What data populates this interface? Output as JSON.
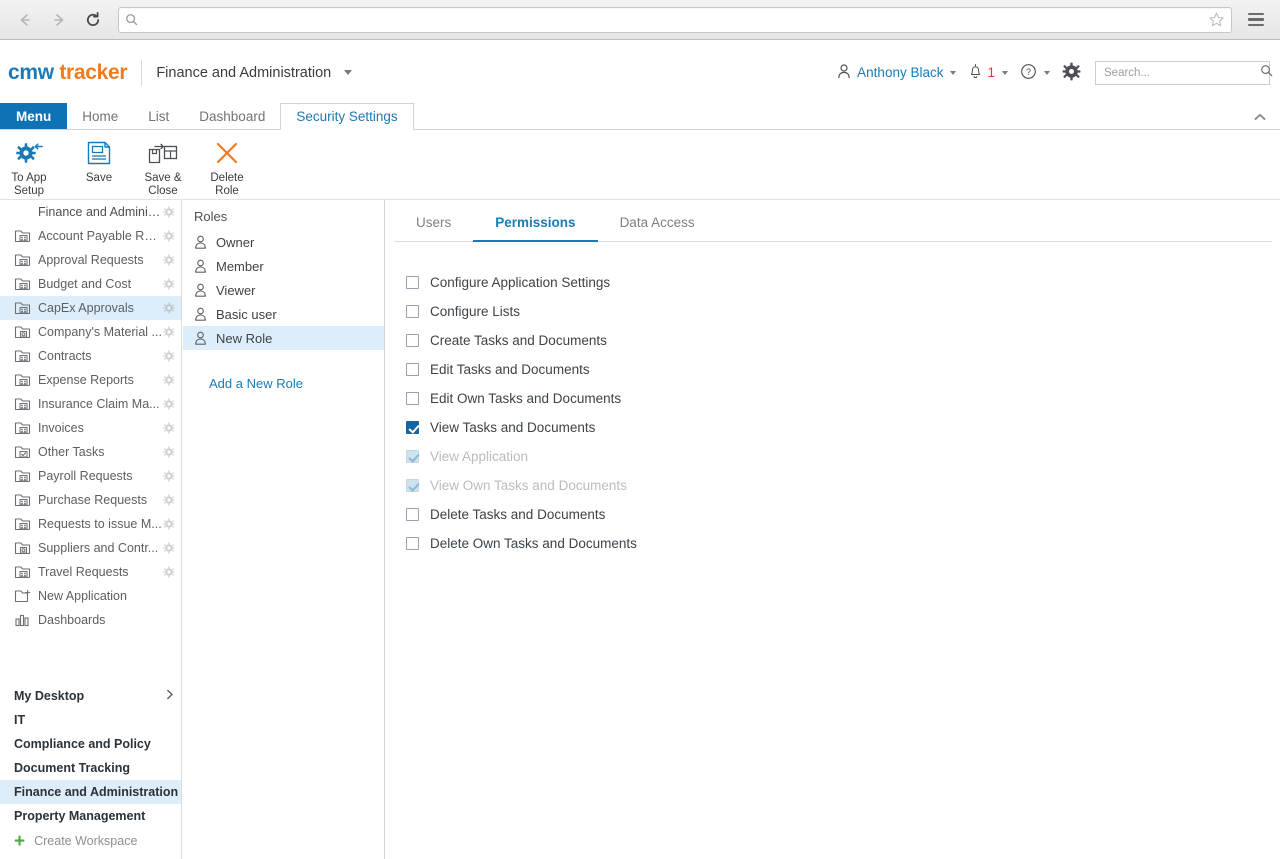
{
  "browser": {
    "back_icon": "arrow-left-icon",
    "forward_icon": "arrow-right-icon",
    "reload_icon": "reload-icon",
    "url_value": "",
    "url_placeholder": "",
    "url_search_icon": "search-icon",
    "bookmark_icon": "star-icon",
    "menu_icon": "hamburger-menu-icon"
  },
  "header": {
    "logo_primary": "cmw",
    "logo_secondary": "tracker",
    "workspace_name": "Finance and Administration",
    "user_icon": "person-icon",
    "user_name": "Anthony Black",
    "bell_icon": "bell-icon",
    "notification_count": "1",
    "help_icon": "question-circle-icon",
    "settings_icon": "gear-icon",
    "search_placeholder": "Search...",
    "search_value": "",
    "search_icon": "search-icon"
  },
  "tabs": [
    {
      "label": "Menu",
      "state": "menu"
    },
    {
      "label": "Home",
      "state": "inactive"
    },
    {
      "label": "List",
      "state": "inactive"
    },
    {
      "label": "Dashboard",
      "state": "inactive"
    },
    {
      "label": "Security Settings",
      "state": "active"
    }
  ],
  "collapse_icon": "chevron-up-icon",
  "ribbon": [
    {
      "label": "To App Setup",
      "icon": "gear-back-arrow-icon",
      "color": "#1a7ab5"
    },
    {
      "label": "Save",
      "icon": "floppy-disk-icon",
      "color": "#1a7ab5"
    },
    {
      "label": "Save & Close",
      "icon": "save-and-close-icon",
      "color": "#4a5056"
    },
    {
      "label": "Delete Role",
      "icon": "x-cross-icon",
      "color": "#ef7b1f"
    }
  ],
  "sidebar": {
    "apps": [
      {
        "label": "Finance and Administrati...",
        "icon": "none",
        "gear": true,
        "selected": false,
        "root": true
      },
      {
        "label": "Account Payable Req...",
        "icon": "app-icon",
        "gear": true,
        "selected": false
      },
      {
        "label": "Approval Requests",
        "icon": "app-icon",
        "gear": true,
        "selected": false
      },
      {
        "label": "Budget and Cost",
        "icon": "app-icon",
        "gear": true,
        "selected": false
      },
      {
        "label": "CapEx Approvals",
        "icon": "app-icon",
        "gear": true,
        "selected": true
      },
      {
        "label": "Company's Material ...",
        "icon": "app-icon-alt",
        "gear": true,
        "selected": false
      },
      {
        "label": "Contracts",
        "icon": "app-icon",
        "gear": true,
        "selected": false
      },
      {
        "label": "Expense Reports",
        "icon": "app-icon",
        "gear": true,
        "selected": false
      },
      {
        "label": "Insurance Claim Ma...",
        "icon": "app-icon",
        "gear": true,
        "selected": false
      },
      {
        "label": "Invoices",
        "icon": "app-icon",
        "gear": true,
        "selected": false
      },
      {
        "label": "Other Tasks",
        "icon": "app-icon-check",
        "gear": true,
        "selected": false
      },
      {
        "label": "Payroll Requests",
        "icon": "app-icon",
        "gear": true,
        "selected": false
      },
      {
        "label": "Purchase Requests",
        "icon": "app-icon",
        "gear": true,
        "selected": false
      },
      {
        "label": "Requests to issue M...",
        "icon": "app-icon",
        "gear": true,
        "selected": false
      },
      {
        "label": "Suppliers and Contr...",
        "icon": "app-icon-alt",
        "gear": true,
        "selected": false
      },
      {
        "label": "Travel Requests",
        "icon": "app-icon",
        "gear": true,
        "selected": false
      },
      {
        "label": "New Application",
        "icon": "new-application-icon",
        "gear": false,
        "selected": false
      },
      {
        "label": "Dashboards",
        "icon": "bar-chart-icon",
        "gear": false,
        "selected": false
      }
    ],
    "workspaces": [
      {
        "label": "My Desktop",
        "chevron": true,
        "selected": false
      },
      {
        "label": "IT",
        "chevron": false,
        "selected": false
      },
      {
        "label": "Compliance and Policy",
        "chevron": false,
        "selected": false
      },
      {
        "label": "Document Tracking",
        "chevron": false,
        "selected": false
      },
      {
        "label": "Finance and Administration",
        "chevron": false,
        "selected": true
      },
      {
        "label": "Property Management",
        "chevron": false,
        "selected": false
      }
    ],
    "create_workspace_label": "Create Workspace",
    "create_workspace_icon": "plus-icon"
  },
  "roles_panel": {
    "title": "Roles",
    "roles": [
      {
        "label": "Owner",
        "selected": false
      },
      {
        "label": "Member",
        "selected": false
      },
      {
        "label": "Viewer",
        "selected": false
      },
      {
        "label": "Basic user",
        "selected": false
      },
      {
        "label": "New Role",
        "selected": true
      }
    ],
    "add_role_label": "Add a New Role"
  },
  "content": {
    "tabs": [
      {
        "label": "Users",
        "active": false
      },
      {
        "label": "Permissions",
        "active": true
      },
      {
        "label": "Data Access",
        "active": false
      }
    ],
    "permissions": [
      {
        "label": "Configure Application Settings",
        "checked": false,
        "disabled": false
      },
      {
        "label": "Configure Lists",
        "checked": false,
        "disabled": false
      },
      {
        "label": "Create Tasks and Documents",
        "checked": false,
        "disabled": false
      },
      {
        "label": "Edit Tasks and Documents",
        "checked": false,
        "disabled": false
      },
      {
        "label": "Edit Own Tasks and Documents",
        "checked": false,
        "disabled": false
      },
      {
        "label": "View Tasks and Documents",
        "checked": true,
        "disabled": false
      },
      {
        "label": "View Application",
        "checked": true,
        "disabled": true
      },
      {
        "label": "View Own Tasks and Documents",
        "checked": true,
        "disabled": true
      },
      {
        "label": "Delete Tasks and Documents",
        "checked": false,
        "disabled": false
      },
      {
        "label": "Delete Own Tasks and Documents",
        "checked": false,
        "disabled": false
      }
    ]
  },
  "colors": {
    "brand_blue": "#1a7ab5",
    "brand_orange": "#ef7b1f",
    "menu_tab_blue": "#0f72b5",
    "selection_blue": "#ddeefa",
    "alert_red": "#e03c31",
    "plus_green": "#49a942"
  }
}
